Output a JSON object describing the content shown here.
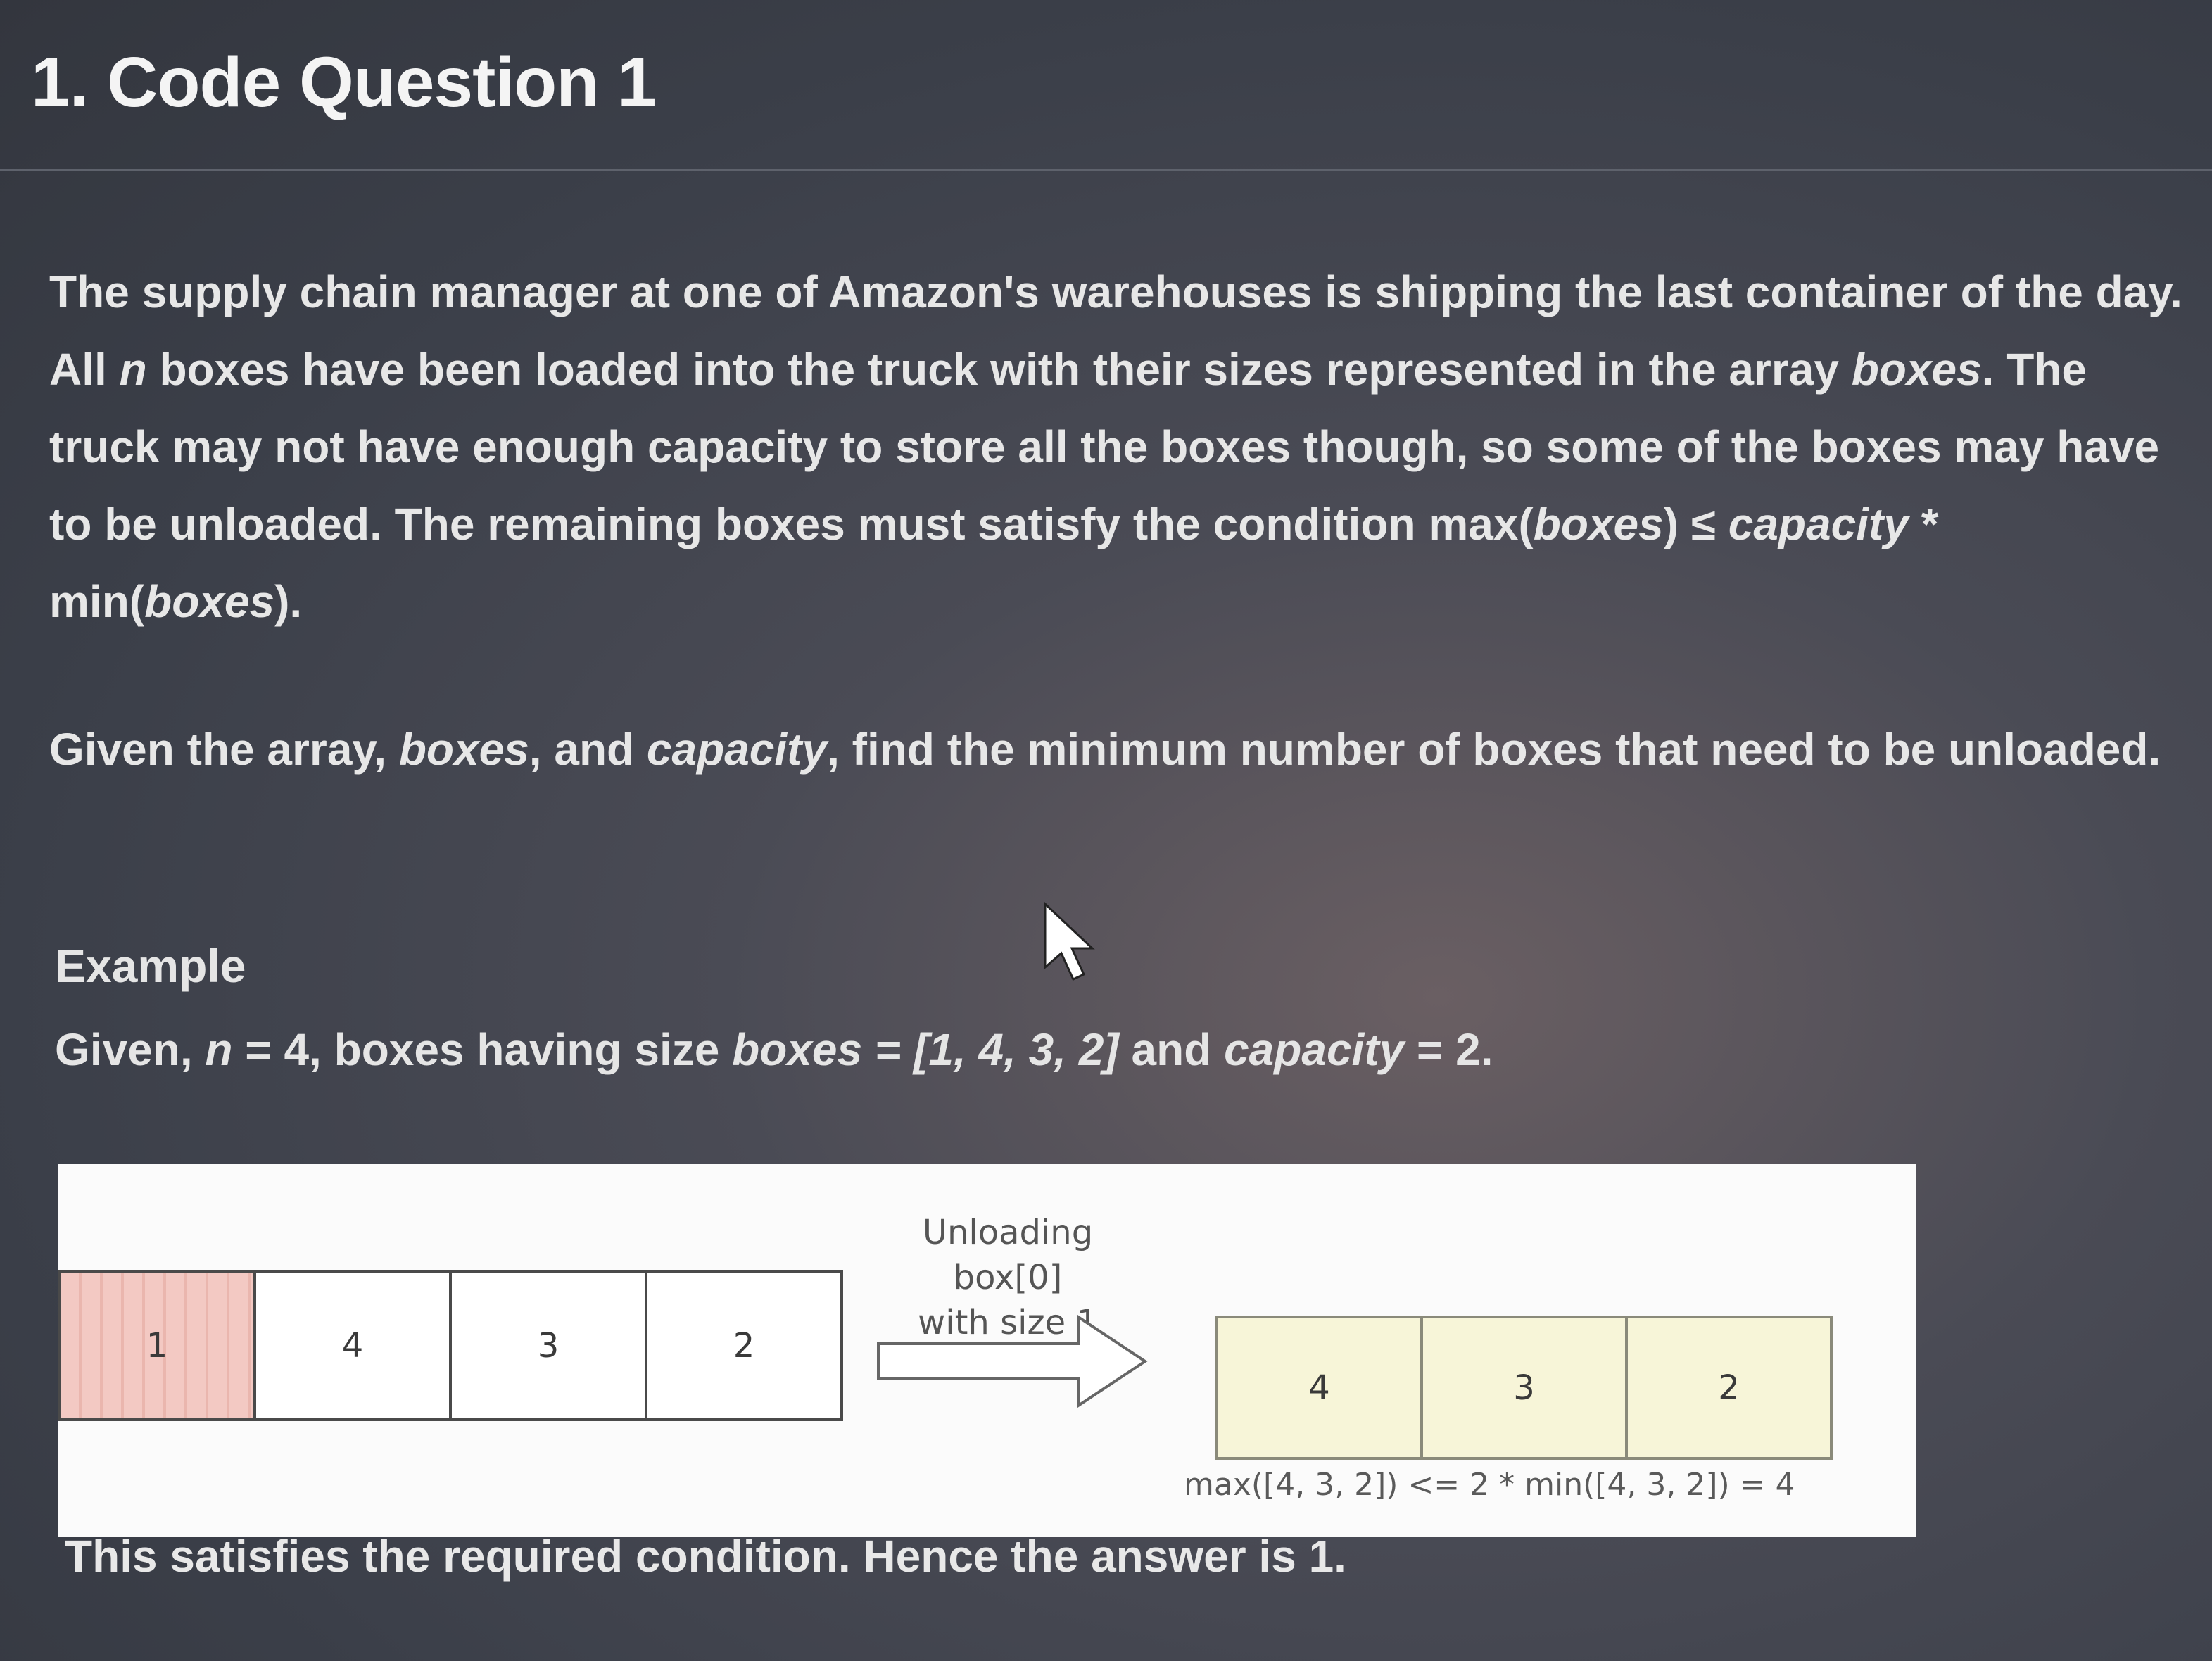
{
  "question": {
    "title": "1. Code Question 1"
  },
  "description": {
    "p1_a": "The supply chain manager at one of Amazon's warehouses is shipping the last container of the day. All ",
    "p1_n": "n",
    "p1_b": " boxes have been loaded into the truck with their sizes represented in the array ",
    "p1_boxes": "boxes",
    "p1_c": ". The truck may not have enough capacity to store all the boxes though, so some of the boxes may have to be unloaded. The remaining boxes must satisfy the condition max(",
    "p1_boxes2": "boxes",
    "p1_d": ") ≤ ",
    "p1_capacity": "capacity",
    "p1_e": " * min(",
    "p1_boxes3": "boxes",
    "p1_f": ").",
    "p2_a": "Given the array, ",
    "p2_boxes": "boxes",
    "p2_b": ", and ",
    "p2_capacity": "capacity",
    "p2_c": ", find the minimum number of boxes that need to be unloaded."
  },
  "example": {
    "heading": "Example",
    "given_a": "Given, ",
    "given_n": "n",
    "given_b": " = 4, boxes having size ",
    "given_boxes": "boxes",
    "given_c": " = [1, 4, 3, 2]",
    "given_d": " and ",
    "given_capacity": "capacity",
    "given_e": " = 2."
  },
  "diagram": {
    "before_boxes": [
      "1",
      "4",
      "3",
      "2"
    ],
    "arrow_caption_line1": "Unloading box[0]",
    "arrow_caption_line2": "with size 1",
    "after_boxes": [
      "4",
      "3",
      "2"
    ],
    "formula": "max([4, 3, 2]) <= 2 * min([4, 3, 2]) = 4",
    "removed_color": "#f3c9c3",
    "remaining_color": "#f7f5d8"
  },
  "conclusion": "This satisfies the required condition. Hence the answer is 1."
}
